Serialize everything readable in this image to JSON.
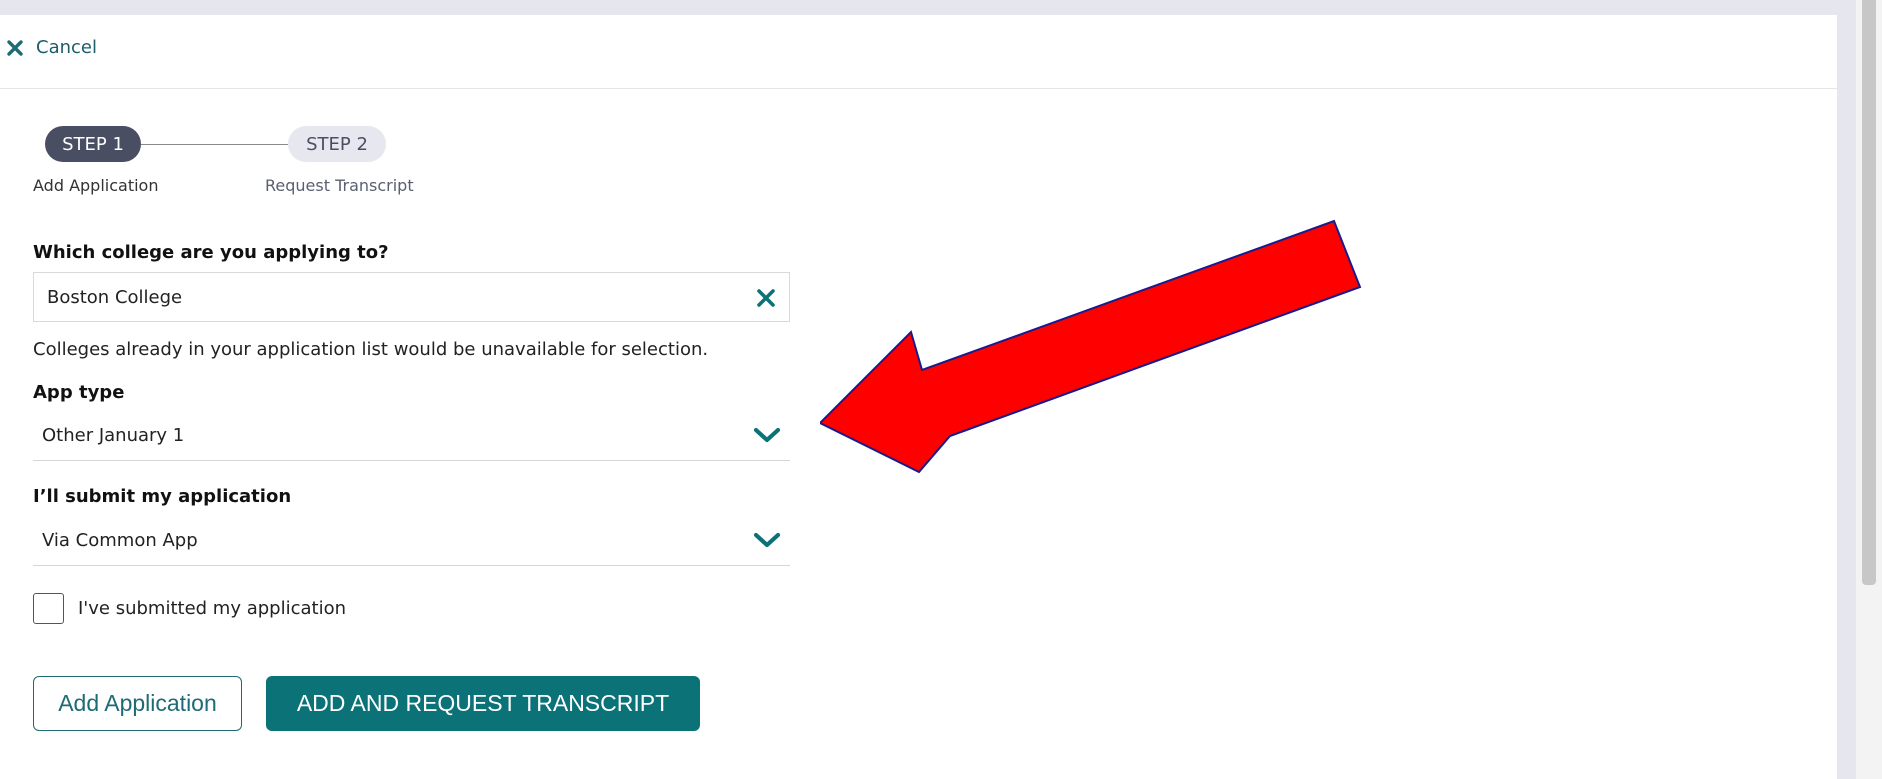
{
  "header": {
    "cancel_label": "Cancel"
  },
  "stepper": {
    "steps": [
      {
        "pill": "STEP 1",
        "label": "Add Application",
        "active": true
      },
      {
        "pill": "STEP 2",
        "label": "Request Transcript",
        "active": false
      }
    ]
  },
  "college": {
    "question": "Which college are you applying to?",
    "value": "Boston College",
    "helper": "Colleges already in your application list would be unavailable for selection."
  },
  "app_type": {
    "label": "App type",
    "value": "Other January 1"
  },
  "submit_via": {
    "label": "I’ll submit my application",
    "value": "Via Common App"
  },
  "submitted_checkbox": {
    "label": "I've submitted my application",
    "checked": false
  },
  "actions": {
    "add_label": "Add Application",
    "add_request_label": "ADD AND REQUEST TRANSCRIPT"
  },
  "colors": {
    "accent": "#0b7278",
    "step_active": "#4a4e63",
    "annotation_arrow": "#ff0000"
  },
  "icons": [
    "close-icon",
    "clear-icon",
    "chevron-down-icon",
    "annotation-arrow"
  ]
}
